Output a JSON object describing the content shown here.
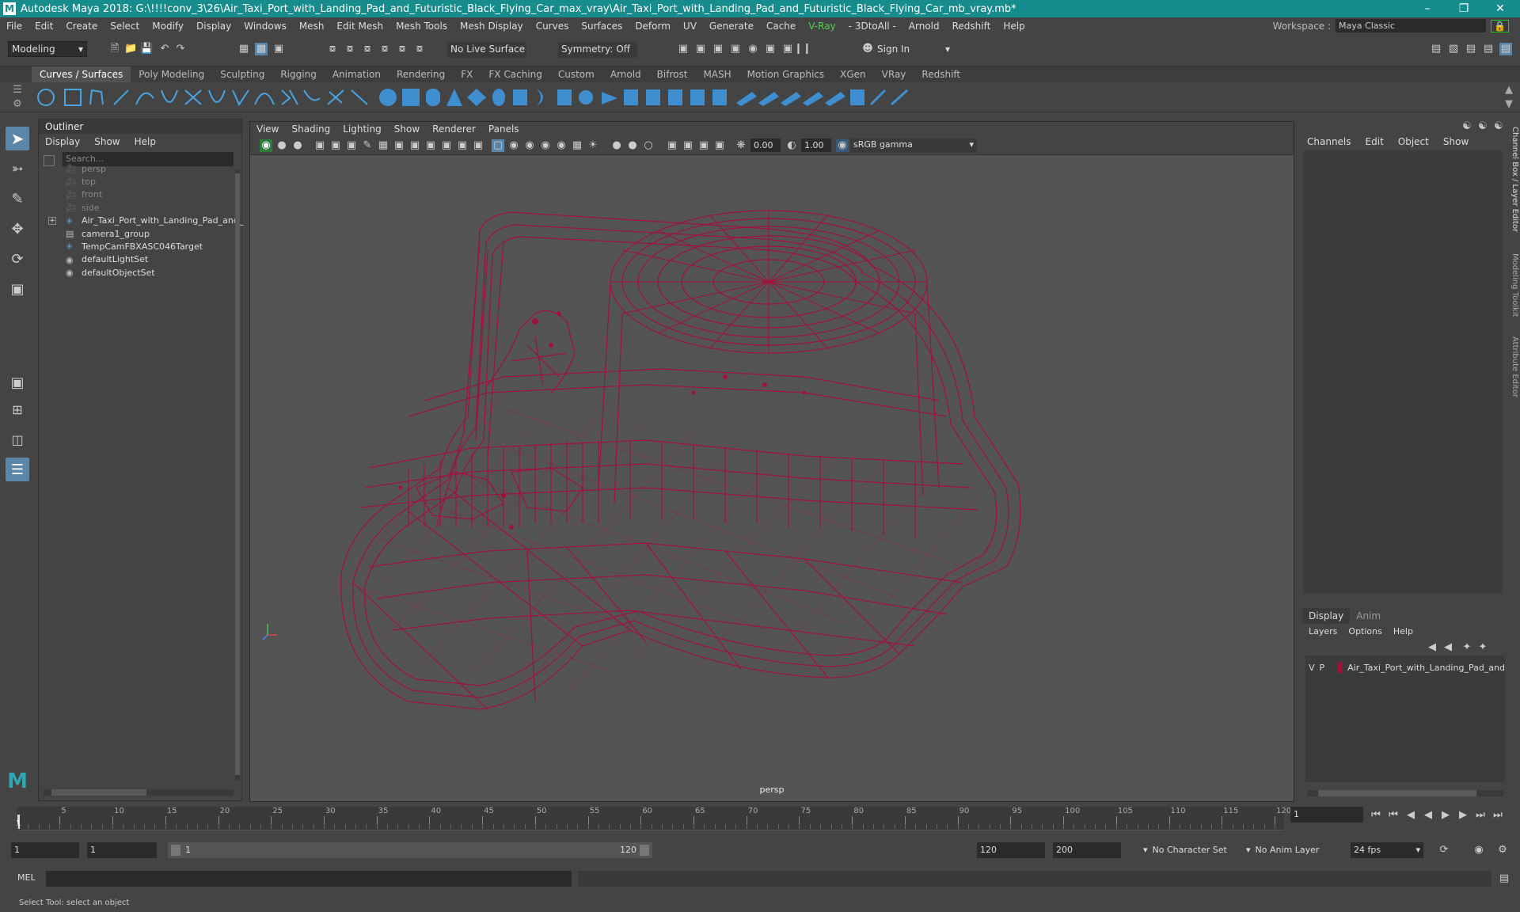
{
  "app": {
    "title": "Autodesk Maya 2018: G:\\!!!!conv_3\\26\\Air_Taxi_Port_with_Landing_Pad_and_Futuristic_Black_Flying_Car_max_vray\\Air_Taxi_Port_with_Landing_Pad_and_Futuristic_Black_Flying_Car_mb_vray.mb*"
  },
  "menu": [
    "File",
    "Edit",
    "Create",
    "Select",
    "Modify",
    "Display",
    "Windows",
    "Mesh",
    "Edit Mesh",
    "Mesh Tools",
    "Mesh Display",
    "Curves",
    "Surfaces",
    "Deform",
    "UV",
    "Generate",
    "Cache",
    "V-Ray",
    "- 3DtoAll -",
    "Arnold",
    "Redshift",
    "Help"
  ],
  "workspace": {
    "label": "Workspace :",
    "value": "Maya Classic"
  },
  "status": {
    "mode": "Modeling",
    "live_surface": "No Live Surface",
    "symmetry": "Symmetry: Off",
    "sign_in": "Sign In"
  },
  "shelf_tabs": [
    "Curves / Surfaces",
    "Poly Modeling",
    "Sculpting",
    "Rigging",
    "Animation",
    "Rendering",
    "FX",
    "FX Caching",
    "Custom",
    "Arnold",
    "Bifrost",
    "MASH",
    "Motion Graphics",
    "XGen",
    "VRay",
    "Redshift"
  ],
  "outliner": {
    "title": "Outliner",
    "menu": [
      "Display",
      "Show",
      "Help"
    ],
    "search_placeholder": "Search...",
    "items": [
      {
        "label": "persp",
        "icon": "camera-icon",
        "dim": true
      },
      {
        "label": "top",
        "icon": "camera-icon",
        "dim": true
      },
      {
        "label": "front",
        "icon": "camera-icon",
        "dim": true
      },
      {
        "label": "side",
        "icon": "camera-icon",
        "dim": true
      },
      {
        "label": "Air_Taxi_Port_with_Landing_Pad_and_",
        "icon": "transform-icon",
        "dim": false
      },
      {
        "label": "camera1_group",
        "icon": "group-icon",
        "dim": false
      },
      {
        "label": "TempCamFBXASC046Target",
        "icon": "transform-icon",
        "dim": false
      },
      {
        "label": "defaultLightSet",
        "icon": "set-icon",
        "dim": false
      },
      {
        "label": "defaultObjectSet",
        "icon": "set-icon",
        "dim": false
      }
    ]
  },
  "viewport": {
    "menu": [
      "View",
      "Shading",
      "Lighting",
      "Show",
      "Renderer",
      "Panels"
    ],
    "exposure": "0.00",
    "gamma": "1.00",
    "color_space": "sRGB gamma",
    "camera": "persp",
    "wire_color": "#a0123c"
  },
  "channel_box": {
    "menu": [
      "Channels",
      "Edit",
      "Object",
      "Show"
    ],
    "side_tabs": [
      "Channel Box / Layer Editor",
      "Modeling Toolkit",
      "Attribute Editor"
    ]
  },
  "layers": {
    "tabs": [
      "Display",
      "Anim"
    ],
    "menu": [
      "Layers",
      "Options",
      "Help"
    ],
    "layer": {
      "v": "V",
      "p": "P",
      "name": "Air_Taxi_Port_with_Landing_Pad_and",
      "color": "#a0123c"
    }
  },
  "timeline": {
    "ticks": [
      "5",
      "10",
      "15",
      "20",
      "25",
      "30",
      "35",
      "40",
      "45",
      "50",
      "55",
      "60",
      "65",
      "70",
      "75",
      "80",
      "85",
      "90",
      "95",
      "100",
      "105",
      "110",
      "115",
      "120"
    ],
    "current_frame": "1",
    "current_marker": "1"
  },
  "range": {
    "start": "1",
    "start2": "1",
    "range_start": "1",
    "range_end": "120",
    "end": "120",
    "end2": "200",
    "character_set": "No Character Set",
    "anim_layer": "No Anim Layer",
    "fps": "24 fps"
  },
  "command": {
    "label": "MEL"
  },
  "help_line": "Select Tool: select an object"
}
